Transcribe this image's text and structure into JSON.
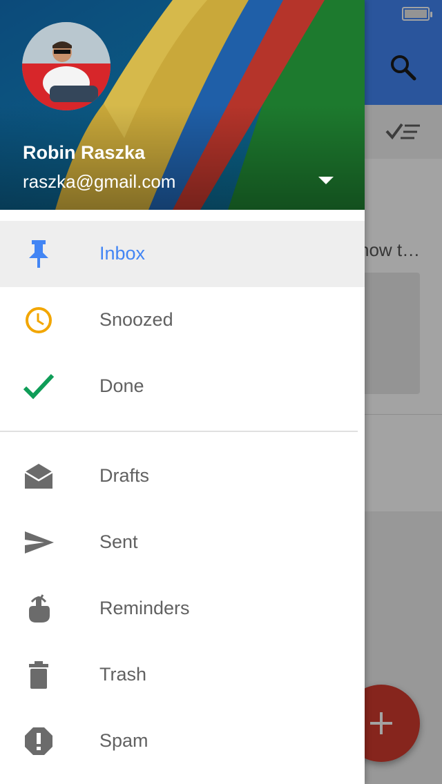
{
  "background_app": {
    "snippet_text": "now t…",
    "search_icon": "search-icon",
    "sweep_icon": "checklist-icon",
    "compose_icon": "plus-icon",
    "colors": {
      "header": "#4285f4",
      "fab": "#d23a2e"
    }
  },
  "drawer": {
    "account": {
      "name": "Robin Raszka",
      "email": "raszka@gmail.com"
    },
    "primary_items": [
      {
        "label": "Inbox",
        "icon": "pin-icon",
        "active": true,
        "icon_color": "#4285f4"
      },
      {
        "label": "Snoozed",
        "icon": "clock-icon",
        "active": false,
        "icon_color": "#f2a600"
      },
      {
        "label": "Done",
        "icon": "check-icon",
        "active": false,
        "icon_color": "#0f9d58"
      }
    ],
    "secondary_items": [
      {
        "label": "Drafts",
        "icon": "open-envelope-icon"
      },
      {
        "label": "Sent",
        "icon": "send-icon"
      },
      {
        "label": "Reminders",
        "icon": "reminder-finger-icon"
      },
      {
        "label": "Trash",
        "icon": "trash-icon"
      },
      {
        "label": "Spam",
        "icon": "spam-icon"
      }
    ]
  }
}
